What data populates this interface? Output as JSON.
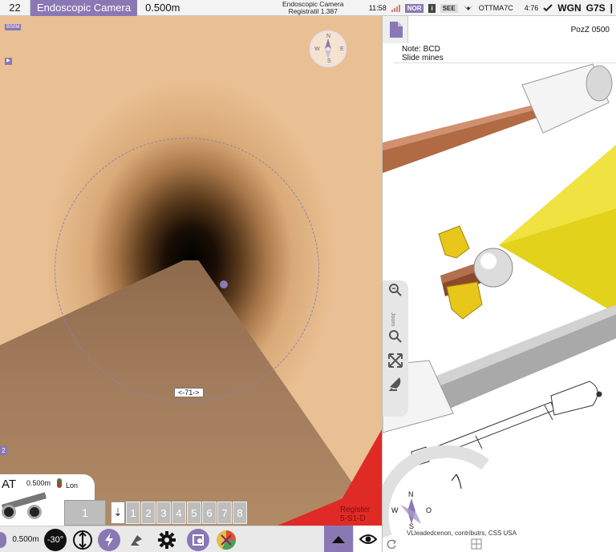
{
  "topbar": {
    "frame_number": "22",
    "title": "Endoscopic Camera",
    "scale": "0.500m",
    "center_line1": "Endoscopic Camera",
    "center_line2": "Registratil 1.387",
    "time": "11:58",
    "nor_label": "NOR",
    "info_label": "i",
    "see_label": "SEE",
    "id_label": "OTTMA7C",
    "ratio": "4:76",
    "right1": "WG",
    "right2": "N",
    "right3": "G7S",
    "accent": "#8a78b4"
  },
  "camera": {
    "badge": "BS0M",
    "compass": {
      "n": "N",
      "s": "S",
      "e": "E",
      "w": "W"
    },
    "distance_marker": "<-71->",
    "register_line1": "Register",
    "register_line2": "5-S1-D",
    "side_badge": "2",
    "overlay": {
      "at_label": "AT",
      "scale": "0.500m",
      "lon_label": "Lon"
    },
    "frame_indicator": "1",
    "frame_strip": [
      "1",
      "2",
      "3",
      "4",
      "5",
      "6",
      "7",
      "8"
    ]
  },
  "bottombar": {
    "scale": "0.500m",
    "angle": "-30°",
    "icons": [
      "ruler-icon",
      "angle-icon",
      "height-icon",
      "lightning-icon",
      "leaf-icon",
      "gear-icon",
      "layers-icon",
      "pie-chart-icon",
      "up-arrow-icon",
      "eye-icon"
    ]
  },
  "right_panel": {
    "poz_label": "PozZ 0500",
    "note_line1": "Note: BCD",
    "note_line2": "Slide mines",
    "tools_label": "Joom",
    "compass": {
      "n": "N",
      "s": "S",
      "o": "O",
      "w": "W"
    },
    "credit": "VLleadedcenon, contributrs, CSS USA",
    "colors": {
      "pipe_brown": "#a05a38",
      "cone_yellow": "#e2d21c",
      "pipe_gray": "#a8a8a8"
    }
  }
}
